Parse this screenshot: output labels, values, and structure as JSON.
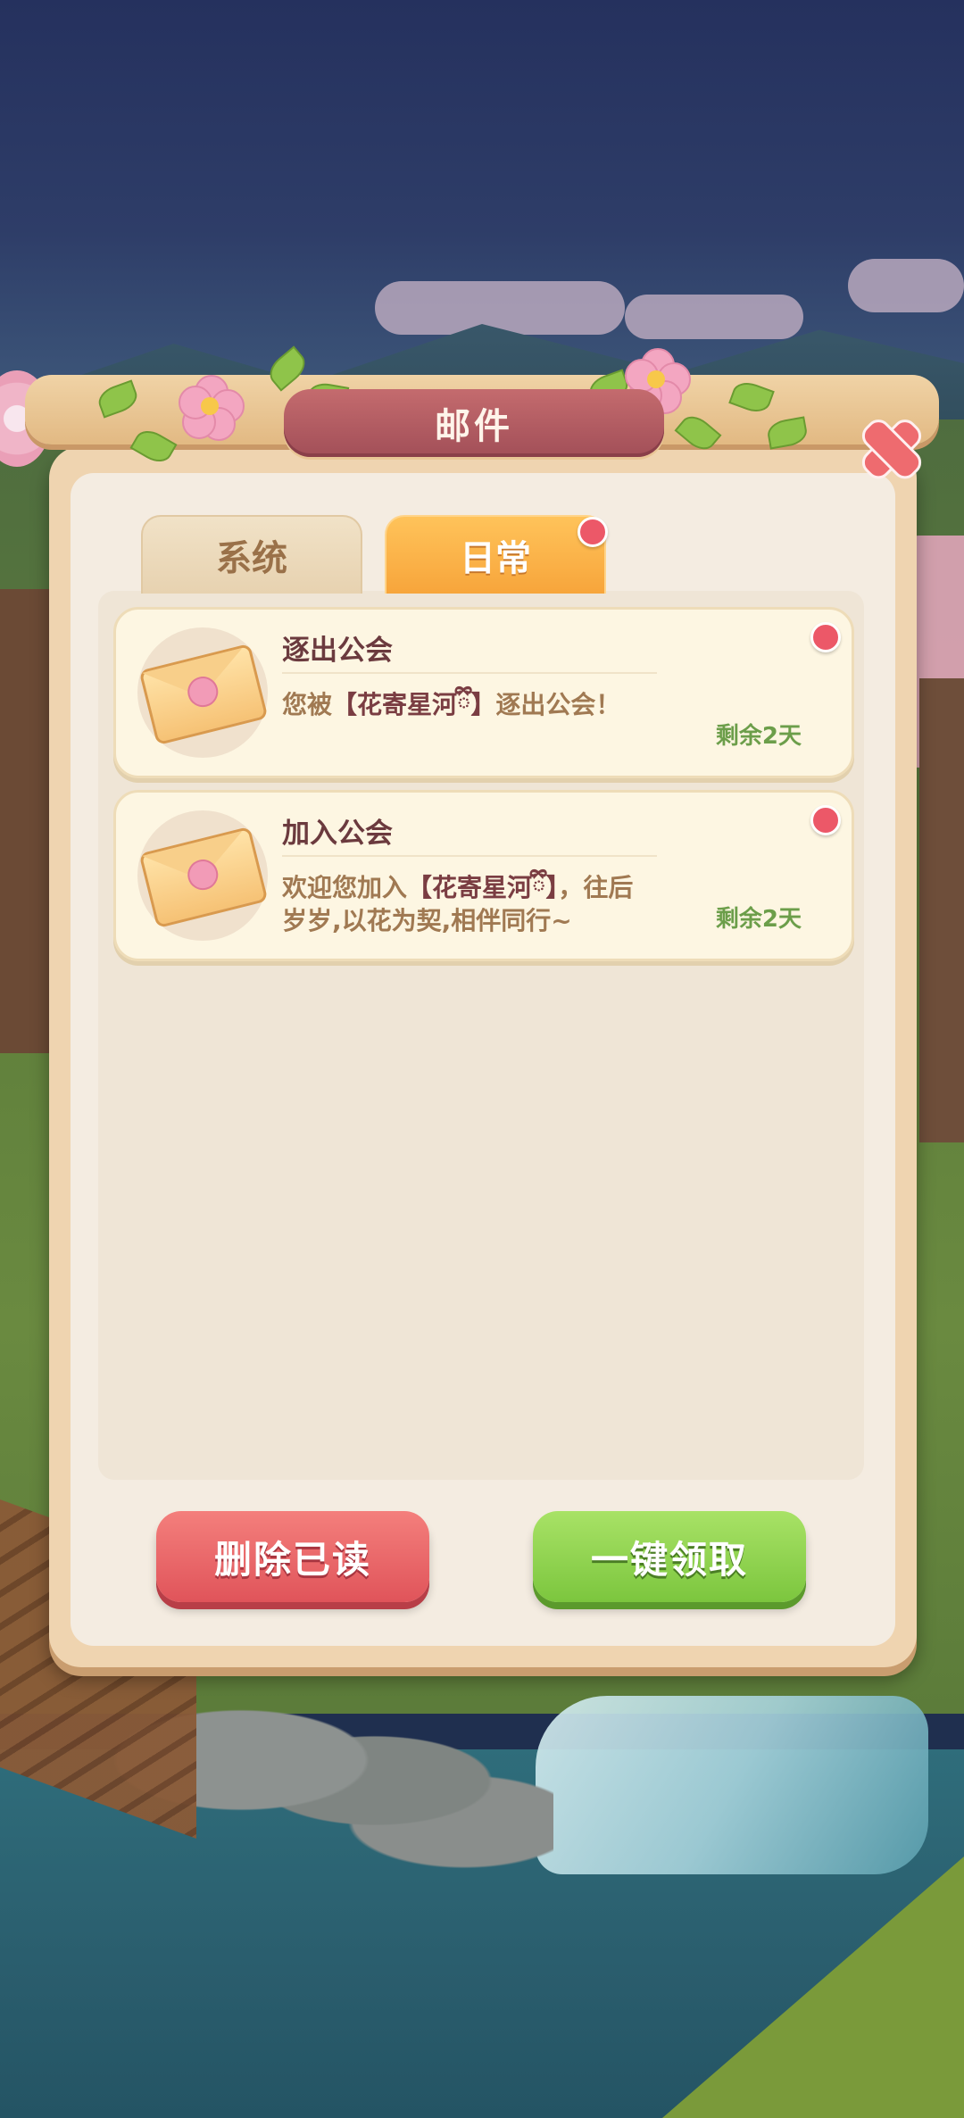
{
  "panel": {
    "title": "邮件"
  },
  "tabs": [
    {
      "label": "系统",
      "active": false,
      "badge": false
    },
    {
      "label": "日常",
      "active": true,
      "badge": true
    }
  ],
  "mails": [
    {
      "title": "逐出公会",
      "body_prefix": "您被",
      "guild": "【花寄星河ྀི】",
      "body_suffix": "逐出公会！",
      "time": "剩余2天",
      "unread": true
    },
    {
      "title": "加入公会",
      "body_prefix": "欢迎您加入",
      "guild": "【花寄星河ྀི】",
      "body_suffix": "，往后岁岁,以花为契,相伴同行~",
      "time": "剩余2天",
      "unread": true
    }
  ],
  "buttons": {
    "delete_read": "删除已读",
    "claim_all": "一键领取"
  },
  "colors": {
    "accent_red": "#e0545a",
    "accent_green": "#7cc63e",
    "tab_active": "#f7a53b",
    "title_plate": "#a24f58"
  },
  "icons": [
    "envelope-icon",
    "close-icon",
    "unread-dot-icon"
  ]
}
